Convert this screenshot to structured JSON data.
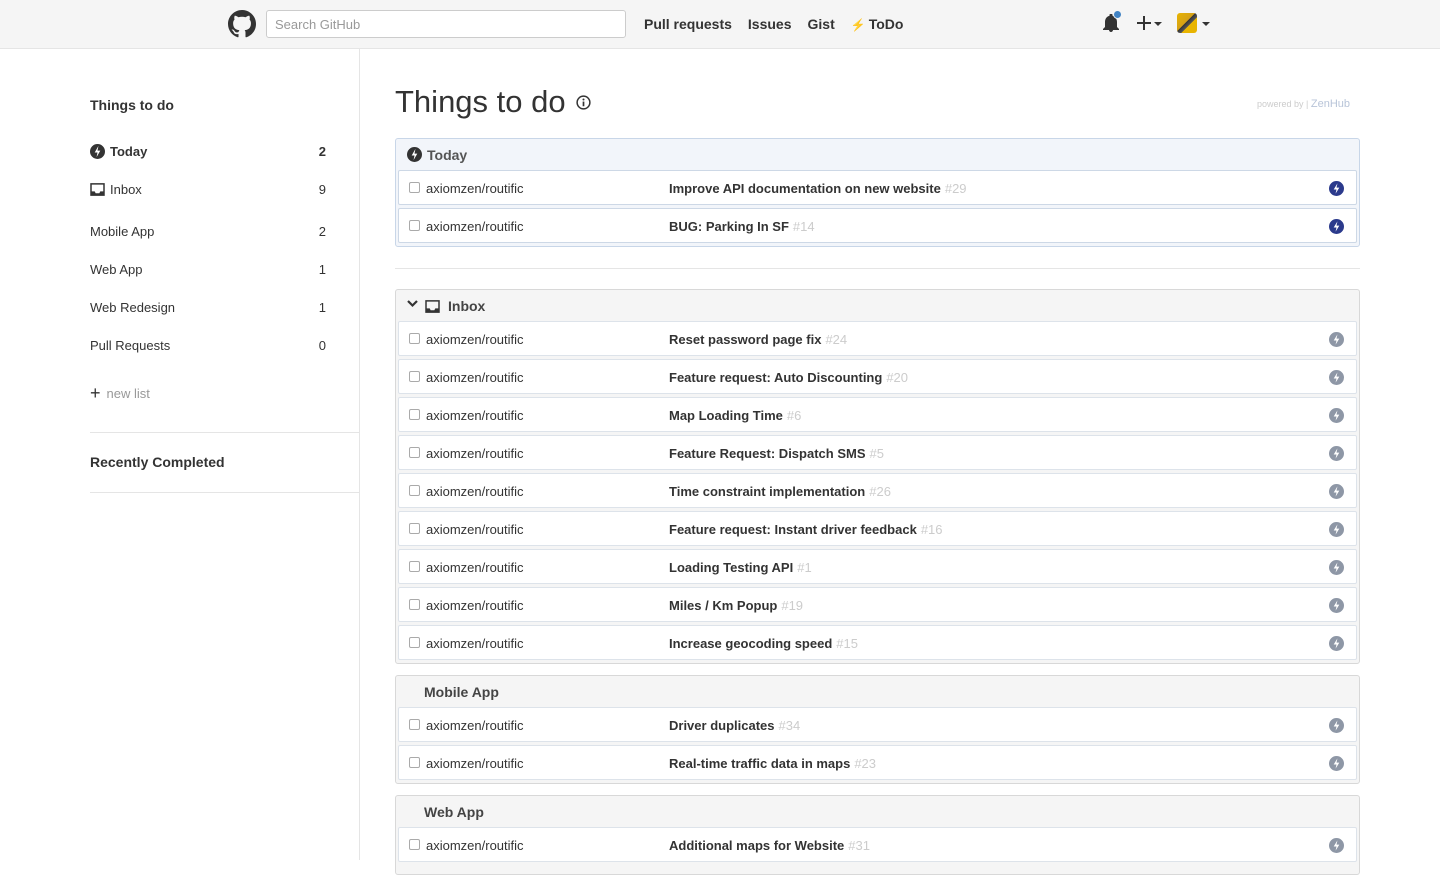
{
  "header": {
    "search_placeholder": "Search GitHub",
    "nav": [
      "Pull requests",
      "Issues",
      "Gist",
      "ToDo"
    ],
    "accent": "#4183c4"
  },
  "sidebar": {
    "title": "Things to do",
    "items": [
      {
        "label": "Today",
        "count": "2",
        "icon": "today-icon"
      },
      {
        "label": "Inbox",
        "count": "9",
        "icon": "inbox-icon"
      },
      {
        "label": "Mobile App",
        "count": "2"
      },
      {
        "label": "Web App",
        "count": "1"
      },
      {
        "label": "Web Redesign",
        "count": "1"
      },
      {
        "label": "Pull Requests",
        "count": "0"
      }
    ],
    "new_list": "new list",
    "recently_completed": "Recently Completed"
  },
  "main": {
    "title": "Things to do",
    "powered_by": "powered by",
    "powered_brand": "ZenHub",
    "groups": [
      {
        "name": "Today",
        "rows": [
          {
            "repo": "axiomzen/routific",
            "title": "Improve API documentation on new website",
            "number": "#29"
          },
          {
            "repo": "axiomzen/routific",
            "title": "BUG: Parking In SF",
            "number": "#14"
          }
        ]
      },
      {
        "name": "Inbox",
        "rows": [
          {
            "repo": "axiomzen/routific",
            "title": "Reset password page fix",
            "number": "#24"
          },
          {
            "repo": "axiomzen/routific",
            "title": "Feature request: Auto Discounting",
            "number": "#20"
          },
          {
            "repo": "axiomzen/routific",
            "title": "Map Loading Time",
            "number": "#6"
          },
          {
            "repo": "axiomzen/routific",
            "title": "Feature Request: Dispatch SMS",
            "number": "#5"
          },
          {
            "repo": "axiomzen/routific",
            "title": "Time constraint implementation",
            "number": "#26"
          },
          {
            "repo": "axiomzen/routific",
            "title": "Feature request: Instant driver feedback",
            "number": "#16"
          },
          {
            "repo": "axiomzen/routific",
            "title": "Loading Testing API",
            "number": "#1"
          },
          {
            "repo": "axiomzen/routific",
            "title": "Miles / Km Popup",
            "number": "#19"
          },
          {
            "repo": "axiomzen/routific",
            "title": "Increase geocoding speed",
            "number": "#15"
          }
        ]
      },
      {
        "name": "Mobile App",
        "rows": [
          {
            "repo": "axiomzen/routific",
            "title": "Driver duplicates",
            "number": "#34"
          },
          {
            "repo": "axiomzen/routific",
            "title": "Real-time traffic data in maps",
            "number": "#23"
          }
        ]
      },
      {
        "name": "Web App",
        "rows": [
          {
            "repo": "axiomzen/routific",
            "title": "Additional maps for Website",
            "number": "#31"
          }
        ]
      }
    ]
  }
}
